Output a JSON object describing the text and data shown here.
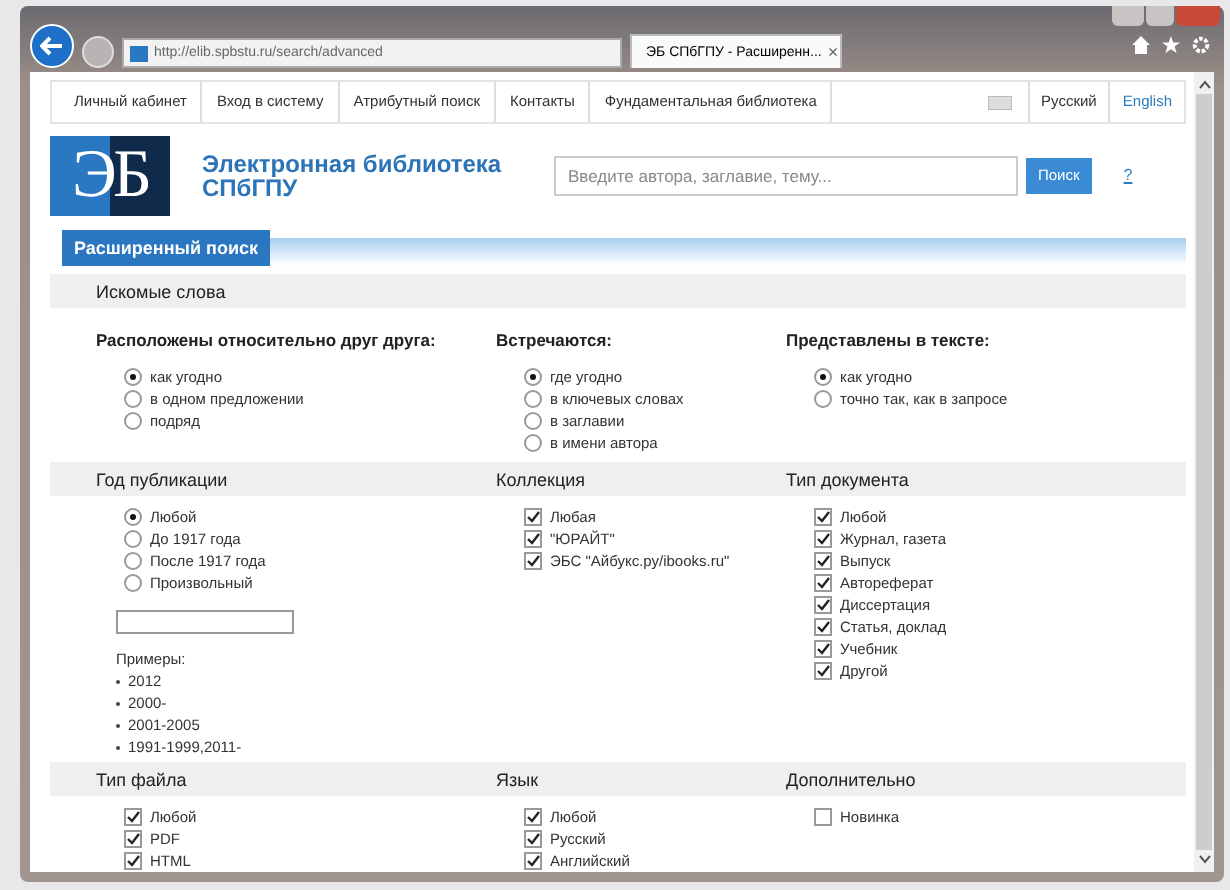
{
  "browser": {
    "address": "http://elib.spbstu.ru/search/advanced",
    "tab_title": "ЭБ СПбГПУ - Расширенн...",
    "tab_close": "×"
  },
  "nav": {
    "items": [
      "Личный кабинет",
      "Вход в систему",
      "Атрибутный поиск",
      "Контакты",
      "Фундаментальная библиотека"
    ],
    "languages": [
      {
        "label": "Русский",
        "selected": true
      },
      {
        "label": "English",
        "selected": false
      }
    ]
  },
  "header": {
    "logo": "ЭБ",
    "title_lines": [
      "Электронная библиотека",
      "СПбГПУ"
    ],
    "search": {
      "placeholder": "Введите автора, заглавие, тему..."
    },
    "search_button": "Поиск",
    "help": "?"
  },
  "page_tab": "Расширенный поиск",
  "sections": [
    {
      "title": "Искомые слова",
      "columns": [
        {
          "subheading": "Расположены относительно друг друга:",
          "kind": "radio",
          "options": [
            {
              "label": "как угодно",
              "selected": true
            },
            {
              "label": "в одном предложении",
              "selected": false
            },
            {
              "label": "подряд",
              "selected": false
            }
          ]
        },
        {
          "subheading": "Встречаются:",
          "kind": "radio",
          "options": [
            {
              "label": "где угодно",
              "selected": true
            },
            {
              "label": "в ключевых словах",
              "selected": false
            },
            {
              "label": "в заглавии",
              "selected": false
            },
            {
              "label": "в имени автора",
              "selected": false
            }
          ]
        },
        {
          "subheading": "Представлены в тексте:",
          "kind": "radio",
          "options": [
            {
              "label": "как угодно",
              "selected": true
            },
            {
              "label": "точно так, как в запросе",
              "selected": false
            }
          ]
        }
      ]
    },
    {
      "columns": [
        {
          "heading": "Год публикации",
          "kind": "radio",
          "options": [
            {
              "label": "Любой",
              "selected": true
            },
            {
              "label": "До 1917 года",
              "selected": false
            },
            {
              "label": "После 1917 года",
              "selected": false
            },
            {
              "label": "Произвольный",
              "selected": false
            }
          ],
          "year_field": true,
          "examples": {
            "label": "Примеры:",
            "items": [
              "2012",
              "2000-",
              "2001-2005",
              "1991-1999,2011-"
            ]
          }
        },
        {
          "heading": "Коллекция",
          "kind": "checkbox",
          "options": [
            {
              "label": "Любая",
              "checked": true
            },
            {
              "label": "\"ЮРАЙТ\"",
              "checked": true
            },
            {
              "label": "ЭБС \"Айбукс.ру/ibooks.ru\"",
              "checked": true
            }
          ]
        },
        {
          "heading": "Тип документа",
          "kind": "checkbox",
          "options": [
            {
              "label": "Любой",
              "checked": true
            },
            {
              "label": "Журнал, газета",
              "checked": true
            },
            {
              "label": "Выпуск",
              "checked": true
            },
            {
              "label": "Автореферат",
              "checked": true
            },
            {
              "label": "Диссертация",
              "checked": true
            },
            {
              "label": "Статья, доклад",
              "checked": true
            },
            {
              "label": "Учебник",
              "checked": true
            },
            {
              "label": "Другой",
              "checked": true
            }
          ]
        }
      ]
    },
    {
      "columns": [
        {
          "heading": "Тип файла",
          "kind": "checkbox",
          "options": [
            {
              "label": "Любой",
              "checked": true
            },
            {
              "label": "PDF",
              "checked": true
            },
            {
              "label": "HTML",
              "checked": true
            }
          ]
        },
        {
          "heading": "Язык",
          "kind": "checkbox",
          "options": [
            {
              "label": "Любой",
              "checked": true
            },
            {
              "label": "Русский",
              "checked": true
            },
            {
              "label": "Английский",
              "checked": true
            }
          ]
        },
        {
          "heading": "Дополнительно",
          "kind": "checkbox",
          "options": [
            {
              "label": "Новинка",
              "checked": false
            }
          ]
        }
      ]
    }
  ]
}
